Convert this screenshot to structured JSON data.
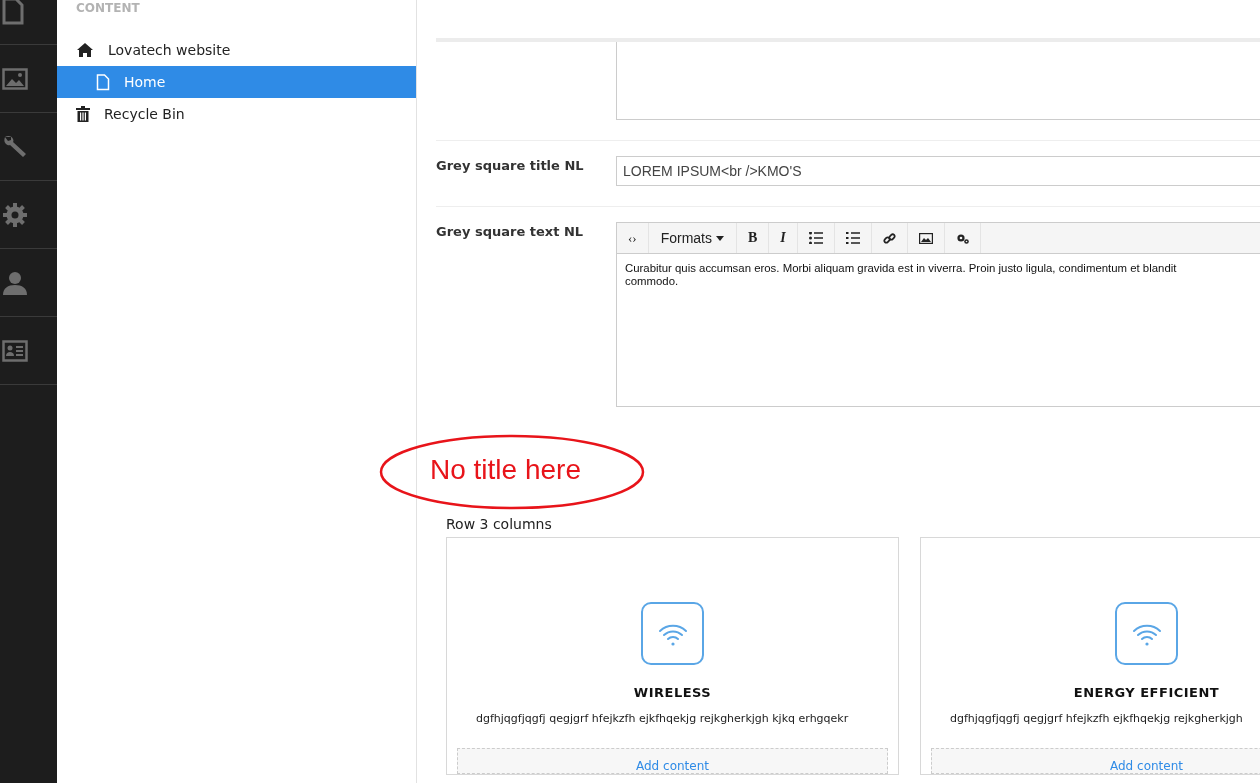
{
  "rail": {
    "items": [
      {
        "kind": "document"
      },
      {
        "kind": "image"
      },
      {
        "kind": "wrench"
      },
      {
        "kind": "gear"
      },
      {
        "kind": "user"
      },
      {
        "kind": "card"
      }
    ]
  },
  "tree": {
    "heading": "CONTENT",
    "items": [
      {
        "label": "Lovatech website",
        "kind": "home",
        "selected": false,
        "children": [
          {
            "label": "Home",
            "kind": "page",
            "selected": true
          }
        ]
      },
      {
        "label": "Recycle Bin",
        "kind": "bin",
        "selected": false
      }
    ]
  },
  "fields": [
    {
      "kind": "textarea"
    },
    {
      "kind": "text",
      "label": "Grey square title NL",
      "value": "LOREM IPSUM<br />KMO'S"
    },
    {
      "kind": "richtext",
      "label": "Grey square text NL",
      "toolbar": [
        {
          "kind": "code",
          "label": "‹›"
        },
        {
          "kind": "formats",
          "label": "Formats"
        },
        {
          "kind": "bold",
          "label": "B"
        },
        {
          "kind": "italic",
          "label": "I"
        },
        {
          "kind": "bullets"
        },
        {
          "kind": "numbers"
        },
        {
          "kind": "link"
        },
        {
          "kind": "image"
        },
        {
          "kind": "macro"
        }
      ],
      "lines": [
        "Curabitur quis accumsan eros. Morbi aliquam gravida est in viverra. Proin justo ligula, condimentum et blandit",
        "commodo."
      ]
    }
  ],
  "annotation": {
    "text": "No title here"
  },
  "grid": {
    "title": "Row 3 columns",
    "cells": [
      {
        "title": "WIRELESS",
        "text": "dgfhjqgfjqgfj qegjgrf hfejkzfh ejkfhqekjg rejkgherkjgh kjkq erhgqekr",
        "add_label": "Add content"
      },
      {
        "title": "ENERGY EFFICIENT",
        "text": "dgfhjqgfjqgfj qegjgrf hfejkzfh ejkfhqekjg rejkgherkjgh",
        "add_label": "Add content"
      }
    ]
  }
}
